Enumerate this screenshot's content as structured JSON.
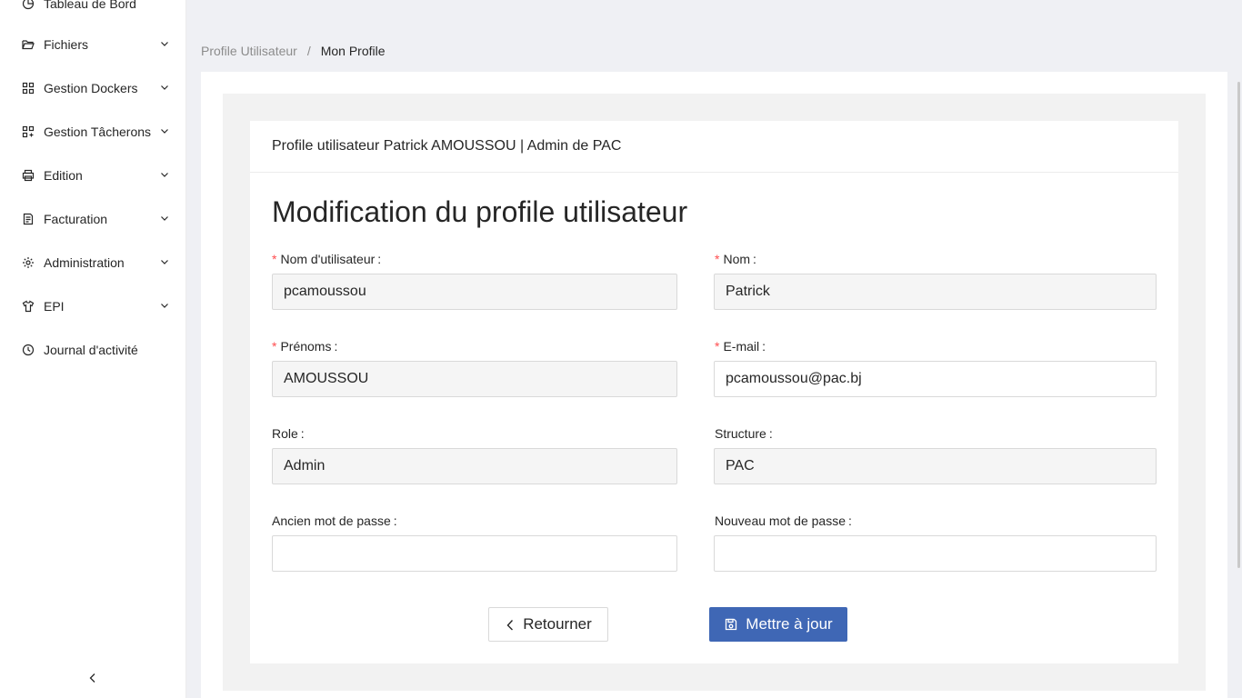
{
  "sidebar": {
    "items": [
      {
        "label": "Tableau de Bord",
        "icon": "pie-chart-icon",
        "has_arrow": false
      },
      {
        "label": "Fichiers",
        "icon": "folder-open-icon",
        "has_arrow": true
      },
      {
        "label": "Gestion Dockers",
        "icon": "appstore-icon",
        "has_arrow": true
      },
      {
        "label": "Gestion Tâcherons",
        "icon": "team-grid-icon",
        "has_arrow": true
      },
      {
        "label": "Edition",
        "icon": "printer-icon",
        "has_arrow": true
      },
      {
        "label": "Facturation",
        "icon": "invoice-icon",
        "has_arrow": true
      },
      {
        "label": "Administration",
        "icon": "gear-icon",
        "has_arrow": true
      },
      {
        "label": "EPI",
        "icon": "shirt-icon",
        "has_arrow": true
      },
      {
        "label": "Journal d'activité",
        "icon": "clock-icon",
        "has_arrow": false
      }
    ],
    "collapse_icon": "chevron-left-icon"
  },
  "breadcrumb": {
    "parent": "Profile Utilisateur",
    "separator": "/",
    "current": "Mon Profile"
  },
  "card": {
    "header": "Profile utilisateur Patrick AMOUSSOU | Admin de PAC",
    "title": "Modification du profile utilisateur"
  },
  "form": {
    "username": {
      "label": "Nom d'utilisateur",
      "value": "pcamoussou",
      "required": true
    },
    "nom": {
      "label": "Nom",
      "value": "Patrick",
      "required": true
    },
    "prenoms": {
      "label": "Prénoms",
      "value": "AMOUSSOU",
      "required": true
    },
    "email": {
      "label": "E-mail",
      "value": "pcamoussou@pac.bj",
      "required": true
    },
    "role": {
      "label": "Role",
      "value": "Admin",
      "required": false
    },
    "structure": {
      "label": "Structure",
      "value": "PAC",
      "required": false
    },
    "old_password": {
      "label": "Ancien mot de passe",
      "value": "",
      "required": false
    },
    "new_password": {
      "label": "Nouveau mot de passe",
      "value": "",
      "required": false
    }
  },
  "buttons": {
    "back": "Retourner",
    "save": "Mettre à jour"
  },
  "colors": {
    "primary": "#3f67b5",
    "required": "#ff4d4f",
    "background": "#eff0f4"
  }
}
